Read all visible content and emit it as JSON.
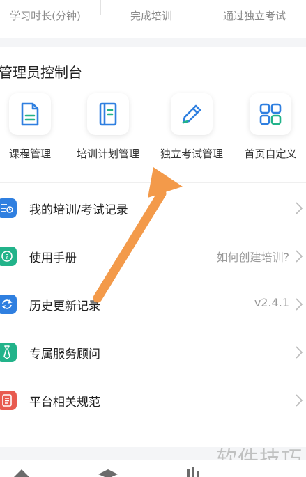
{
  "stats": {
    "items": [
      {
        "label": "学习时长(分钟)"
      },
      {
        "label": "完成培训"
      },
      {
        "label": "通过独立考试"
      }
    ]
  },
  "admin": {
    "title": "管理员控制台",
    "tiles": [
      {
        "label": "课程管理",
        "icon": "document-icon"
      },
      {
        "label": "培训计划管理",
        "icon": "notebook-icon"
      },
      {
        "label": "独立考试管理",
        "icon": "pencil-icon"
      },
      {
        "label": "首页自定义",
        "icon": "grid-icon"
      }
    ]
  },
  "menu": {
    "items": [
      {
        "label": "我的培训/考试记录",
        "value": "",
        "icon": "record-icon",
        "color": "#2f7fe0"
      },
      {
        "label": "使用手册",
        "value": "如何创建培训?",
        "icon": "question-icon",
        "color": "#22b38a"
      },
      {
        "label": "历史更新记录",
        "value": "v2.4.1",
        "icon": "refresh-icon",
        "color": "#2f7fe0"
      },
      {
        "label": "专属服务顾问",
        "value": "",
        "icon": "tie-icon",
        "color": "#22b38a"
      },
      {
        "label": "平台相关规范",
        "value": "",
        "icon": "list-doc-icon",
        "color": "#e85a4f"
      }
    ]
  },
  "watermark": "软件技巧",
  "colors": {
    "accent_blue": "#2f7fe0",
    "accent_teal": "#22b38a",
    "accent_red": "#e85a4f",
    "arrow_orange": "#f39a4a"
  }
}
